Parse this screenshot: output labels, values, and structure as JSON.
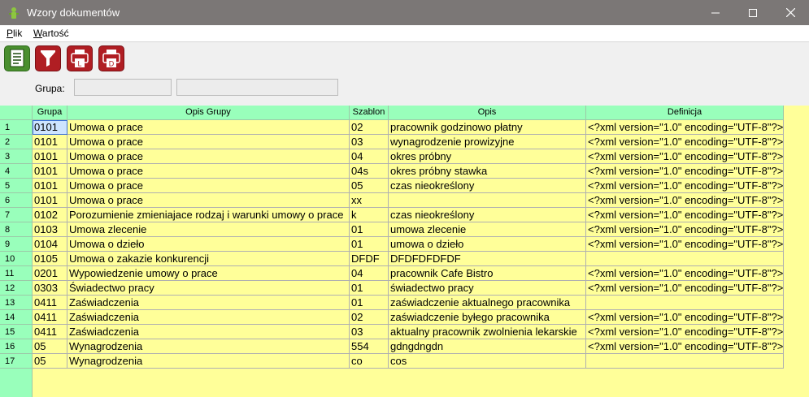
{
  "window": {
    "title": "Wzory dokumentów",
    "controls": [
      "—",
      "☐",
      "✕"
    ]
  },
  "menu": {
    "items": [
      {
        "label": "Plik",
        "underline": "P",
        "rest": "lik"
      },
      {
        "label": "Wartość",
        "underline": "W",
        "rest": "artość"
      }
    ]
  },
  "toolbar": {
    "buttons": [
      {
        "icon": "document-list-icon",
        "color": "#4a8f2f"
      },
      {
        "icon": "filter-icon",
        "color": "#b01e23"
      },
      {
        "icon": "print-l-icon",
        "color": "#b01e23",
        "letter": "L"
      },
      {
        "icon": "print-d-icon",
        "color": "#b01e23",
        "letter": "D"
      }
    ]
  },
  "filter": {
    "label": "Grupa:",
    "code_value": "",
    "name_value": ""
  },
  "table": {
    "columns": [
      "Grupa",
      "Opis Grupy",
      "Szablon",
      "Opis",
      "Definicja"
    ],
    "rows": [
      {
        "n": "1",
        "grupa": "0101",
        "opis_grupy": "Umowa o prace",
        "szablon": "02",
        "opis": "pracownik godzinowo płatny",
        "definicja": "<?xml version=\"1.0\" encoding=\"UTF-8\"?>"
      },
      {
        "n": "2",
        "grupa": "0101",
        "opis_grupy": "Umowa o prace",
        "szablon": "03",
        "opis": "wynagrodzenie prowizyjne",
        "definicja": "<?xml version=\"1.0\" encoding=\"UTF-8\"?>"
      },
      {
        "n": "3",
        "grupa": "0101",
        "opis_grupy": "Umowa o prace",
        "szablon": "04",
        "opis": "okres próbny",
        "definicja": "<?xml version=\"1.0\" encoding=\"UTF-8\"?>"
      },
      {
        "n": "4",
        "grupa": "0101",
        "opis_grupy": "Umowa o prace",
        "szablon": "04s",
        "opis": "okres próbny stawka",
        "definicja": "<?xml version=\"1.0\" encoding=\"UTF-8\"?>"
      },
      {
        "n": "5",
        "grupa": "0101",
        "opis_grupy": "Umowa o prace",
        "szablon": "05",
        "opis": "czas nieokreślony",
        "definicja": "<?xml version=\"1.0\" encoding=\"UTF-8\"?>"
      },
      {
        "n": "6",
        "grupa": "0101",
        "opis_grupy": "Umowa o prace",
        "szablon": "xx",
        "opis": "",
        "definicja": "<?xml version=\"1.0\" encoding=\"UTF-8\"?>"
      },
      {
        "n": "7",
        "grupa": "0102",
        "opis_grupy": "Porozumienie zmieniajace rodzaj i warunki umowy o prace",
        "szablon": "k",
        "opis": "czas nieokreślony",
        "definicja": "<?xml version=\"1.0\" encoding=\"UTF-8\"?>"
      },
      {
        "n": "8",
        "grupa": "0103",
        "opis_grupy": "Umowa zlecenie",
        "szablon": "01",
        "opis": "umowa zlecenie",
        "definicja": "<?xml version=\"1.0\" encoding=\"UTF-8\"?>"
      },
      {
        "n": "9",
        "grupa": "0104",
        "opis_grupy": "Umowa o dzieło",
        "szablon": "01",
        "opis": "umowa o dzieło",
        "definicja": "<?xml version=\"1.0\" encoding=\"UTF-8\"?>"
      },
      {
        "n": "10",
        "grupa": "0105",
        "opis_grupy": "Umowa o zakazie konkurencji",
        "szablon": "DFDF",
        "opis": "DFDFDFDFDF",
        "definicja": ""
      },
      {
        "n": "11",
        "grupa": "0201",
        "opis_grupy": "Wypowiedzenie umowy o prace",
        "szablon": "04",
        "opis": "pracownik Cafe Bistro",
        "definicja": "<?xml version=\"1.0\" encoding=\"UTF-8\"?>"
      },
      {
        "n": "12",
        "grupa": "0303",
        "opis_grupy": "Świadectwo pracy",
        "szablon": "01",
        "opis": "świadectwo pracy",
        "definicja": "<?xml version=\"1.0\" encoding=\"UTF-8\"?>"
      },
      {
        "n": "13",
        "grupa": "0411",
        "opis_grupy": "Zaświadczenia",
        "szablon": "01",
        "opis": "zaświadczenie aktualnego pracownika",
        "definicja": ""
      },
      {
        "n": "14",
        "grupa": "0411",
        "opis_grupy": "Zaświadczenia",
        "szablon": "02",
        "opis": "zaświadczenie byłego pracownika",
        "definicja": "<?xml version=\"1.0\" encoding=\"UTF-8\"?>"
      },
      {
        "n": "15",
        "grupa": "0411",
        "opis_grupy": "Zaświadczenia",
        "szablon": "03",
        "opis": "aktualny pracownik zwolnienia lekarskie",
        "definicja": "<?xml version=\"1.0\" encoding=\"UTF-8\"?>"
      },
      {
        "n": "16",
        "grupa": "05",
        "opis_grupy": "Wynagrodzenia",
        "szablon": "554",
        "opis": "gdngdngdn",
        "definicja": "<?xml version=\"1.0\" encoding=\"UTF-8\"?>"
      },
      {
        "n": "17",
        "grupa": "05",
        "opis_grupy": "Wynagrodzenia",
        "szablon": "co",
        "opis": "cos",
        "definicja": ""
      }
    ]
  }
}
